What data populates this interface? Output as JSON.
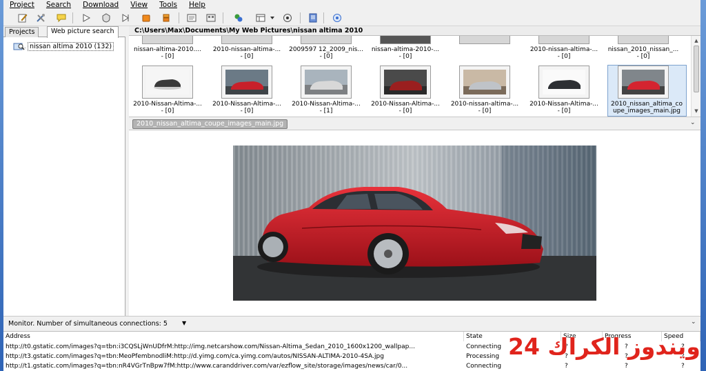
{
  "menubar": {
    "items": [
      "Project",
      "Search",
      "Download",
      "View",
      "Tools",
      "Help"
    ]
  },
  "left_panel": {
    "tabs": [
      "Projects",
      "Web picture search"
    ],
    "tree_item": "nissan altima 2010 (132)"
  },
  "path": "C:\\Users\\Max\\Documents\\My Web Pictures\\nissan altima 2010",
  "thumbs_top": [
    {
      "l1": "nissan-altima-2010....",
      "l2": "- [0]"
    },
    {
      "l1": "2010-nissan-altima-...",
      "l2": "- [0]"
    },
    {
      "l1": "2009597 12_2009_nis...",
      "l2": "- [0]"
    },
    {
      "l1": "nissan-altima-2010-...",
      "l2": "- [0]"
    },
    {
      "l1": "2010-nissan-altima-...",
      "l2": "- [0]"
    },
    {
      "l1": "nissan_2010_nissan_...",
      "l2": "- [0]"
    }
  ],
  "thumbs_bottom": [
    {
      "l1": "2010-Nissan-Altima-...",
      "l2": "- [0]"
    },
    {
      "l1": "2010-Nissan-Altima-...",
      "l2": "- [0]"
    },
    {
      "l1": "2010-Nissan-Altima-...",
      "l2": "- [1]"
    },
    {
      "l1": "2010-Nissan-Altima-...",
      "l2": "- [0]"
    },
    {
      "l1": "2010-nissan-altima-...",
      "l2": "- [0]"
    },
    {
      "l1": "2010-Nissan-Altima-...",
      "l2": "- [0]"
    },
    {
      "l1": "2010_nissan_altima_co",
      "l2": "upe_images_main.jpg"
    }
  ],
  "current_file": "2010_nissan_altima_coupe_images_main.jpg",
  "monitor": {
    "label": "Monitor. Number of simultaneous connections: 5"
  },
  "monitor_table": {
    "headers": [
      "Address",
      "State",
      "Size",
      "Progress",
      "Speed"
    ],
    "rows": [
      {
        "address": "http://t0.gstatic.com/images?q=tbn:i3CQSLjWnUDfrM:http://img.netcarshow.com/Nissan-Altima_Sedan_2010_1600x1200_wallpap...",
        "state": "Connecting",
        "size": "?",
        "progress": "?",
        "speed": "?"
      },
      {
        "address": "http://t3.gstatic.com/images?q=tbn:MeoPfembnodliM:http://d.yimg.com/ca.yimg.com/autos/NISSAN-ALTIMA-2010-4SA.jpg",
        "state": "Processing",
        "size": "?",
        "progress": "?",
        "speed": "?"
      },
      {
        "address": "http://t1.gstatic.com/images?q=tbn:nR4VGrTnBpw7fM:http://www.caranddriver.com/var/ezflow_site/storage/images/news/car/0...",
        "state": "Connecting",
        "size": "?",
        "progress": "?",
        "speed": "?"
      }
    ]
  },
  "watermark": "ويندوز الكراك 24",
  "colors": {
    "accent": "#2f64b6",
    "car_red": "#c8202a",
    "watermark": "#e0241c"
  }
}
